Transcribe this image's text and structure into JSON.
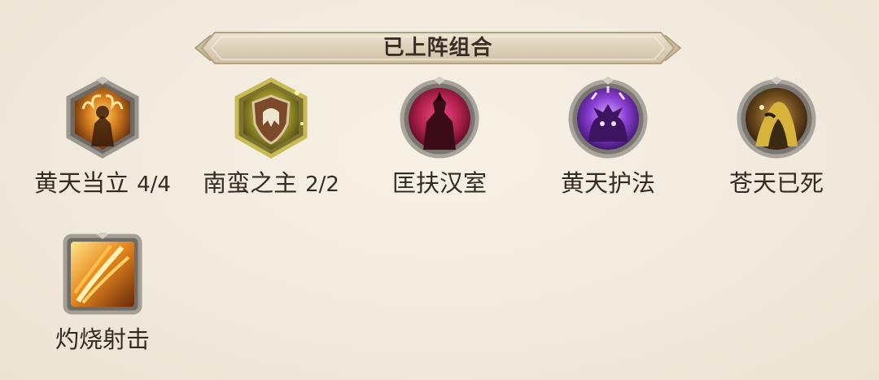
{
  "panel": {
    "title": "已上阵组合"
  },
  "synergies": [
    {
      "name": "黄天当立",
      "count": "4/4",
      "icon": "flame-warrior-icon",
      "frame": "silver-hexagon",
      "theme": "#c9781f"
    },
    {
      "name": "南蛮之主",
      "count": "2/2",
      "icon": "tribal-shield-icon",
      "frame": "gold-hexagon",
      "theme": "#8e8a2a"
    },
    {
      "name": "匡扶汉室",
      "count": "",
      "icon": "crimson-lord-icon",
      "frame": "silver-circle",
      "theme": "#c0335c"
    },
    {
      "name": "黄天护法",
      "count": "",
      "icon": "purple-beast-icon",
      "frame": "silver-circle",
      "theme": "#7a3bc4"
    },
    {
      "name": "苍天已死",
      "count": "",
      "icon": "hooded-sage-icon",
      "frame": "silver-circle",
      "theme": "#6b4a1e"
    },
    {
      "name": "灼烧射击",
      "count": "",
      "icon": "burning-shot-icon",
      "frame": "silver-square",
      "theme": "#d06a18"
    }
  ]
}
